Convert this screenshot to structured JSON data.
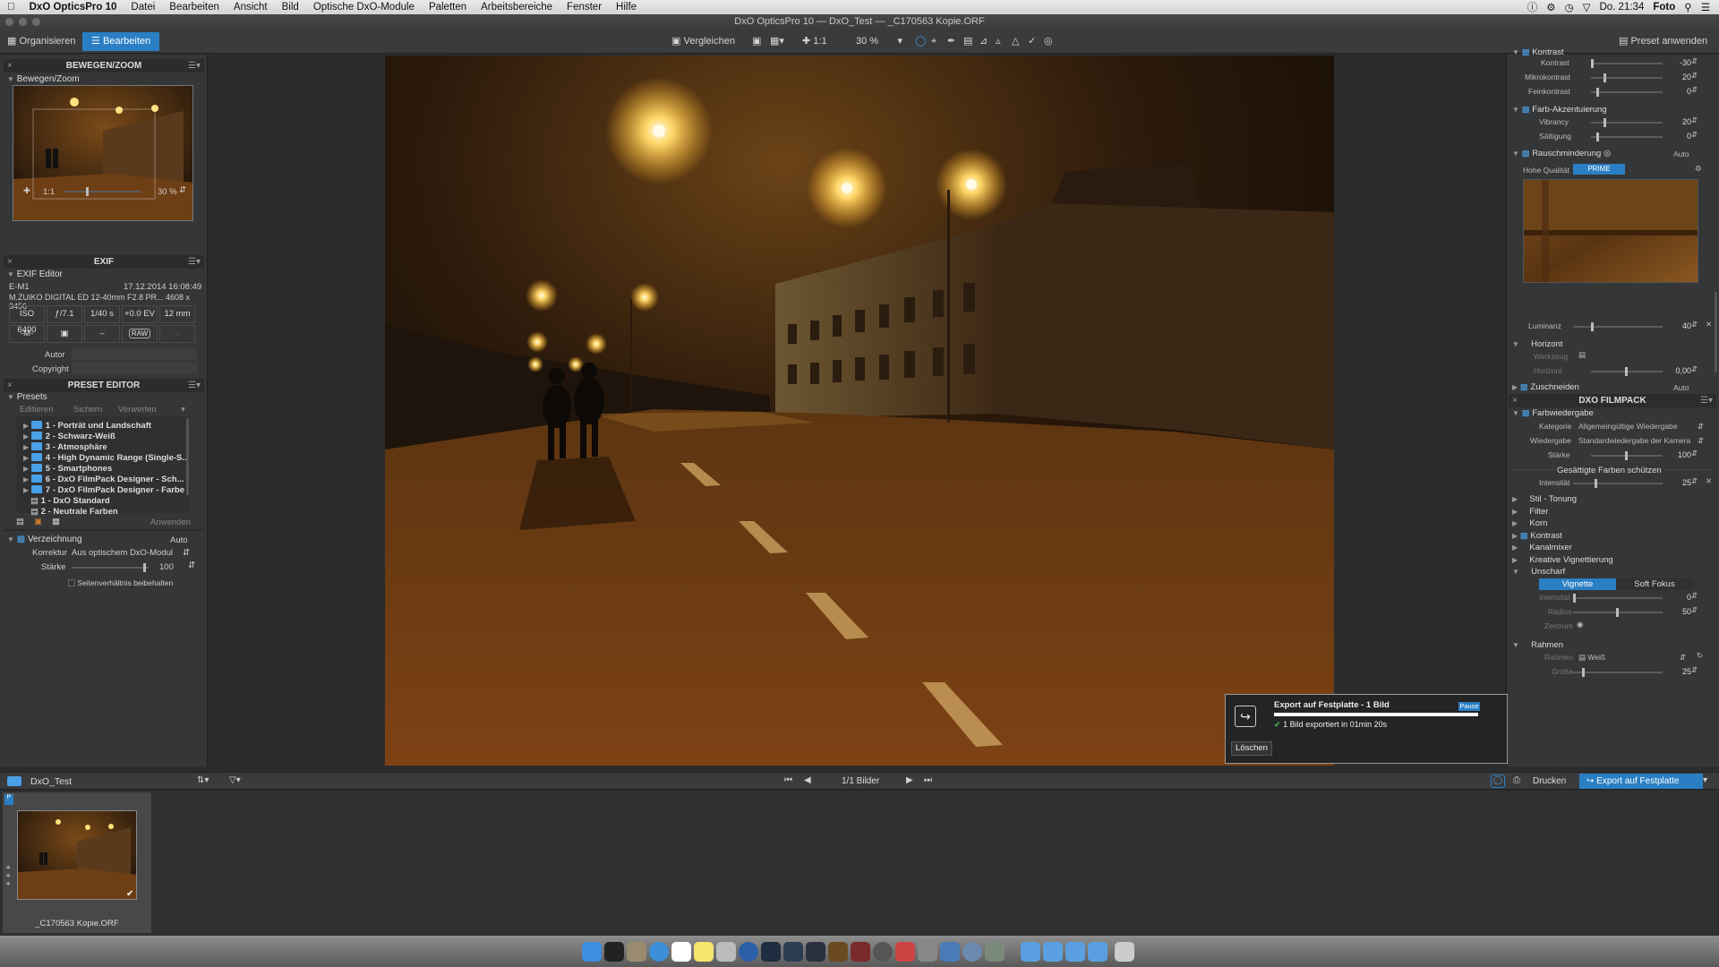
{
  "menubar": {
    "app": "DxO OpticsPro 10",
    "items": [
      "Datei",
      "Bearbeiten",
      "Ansicht",
      "Bild",
      "Optische DxO-Module",
      "Paletten",
      "Arbeitsbereiche",
      "Fenster",
      "Hilfe"
    ],
    "clock": "Do. 21:34",
    "user": "Foto"
  },
  "window": {
    "title": "DxO OpticsPro 10 — DxO_Test — _C170563 Kopie.ORF"
  },
  "toolbar": {
    "tab_organize": "Organisieren",
    "tab_edit": "Bearbeiten",
    "compare": "Vergleichen",
    "one_to_one": "1:1",
    "zoom": "30 %",
    "apply_preset": "Preset anwenden"
  },
  "left": {
    "move_zoom": {
      "header": "BEWEGEN/ZOOM",
      "sub": "Bewegen/Zoom",
      "ratio": "1:1",
      "zoom": "30 %"
    },
    "exif": {
      "header": "EXIF",
      "sub": "EXIF Editor",
      "camera": "E-M1",
      "date": "17.12.2014 16:08:49",
      "lens": "M.ZUIKO DIGITAL ED 12-40mm F2.8 PR... 4608 x 3456",
      "iso": "ISO 6400",
      "aperture": "ƒ/7.1",
      "shutter": "1/40 s",
      "ev": "+0.0 EV",
      "focal": "12 mm",
      "mode": "-M-",
      "flash": "–",
      "raw": "RAW",
      "author_label": "Autor",
      "copyright_label": "Copyright"
    },
    "preset_editor": {
      "header": "PRESET EDITOR",
      "sub": "Presets",
      "edit": "Editieren",
      "save": "Sichern",
      "discard": "Verwerfen",
      "items": [
        "1 - Porträt und Landschaft",
        "2 - Schwarz-Weiß",
        "3 - Atmosphäre",
        "4 - High Dynamic Range (Single-S...",
        "5 - Smartphones",
        "6 - DxO FilmPack Designer - Sch...",
        "7 - DxO FilmPack Designer - Farbe",
        "1 - DxO Standard",
        "2 - Neutrale Farben"
      ],
      "apply": "Anwenden"
    },
    "distortion": {
      "title": "Verzeichnung",
      "auto": "Auto",
      "correction_label": "Korrektur",
      "correction_value": "Aus optischem DxO-Modul",
      "strength_label": "Stärke",
      "strength_value": "100",
      "keep_ratio": "Seitenverhältnis beibehalten"
    }
  },
  "right": {
    "contrast": {
      "title": "Kontrast",
      "contrast_label": "Kontrast",
      "contrast_value": "-30",
      "micro_label": "Mikrokontrast",
      "micro_value": "20",
      "fine_label": "Feinkontrast",
      "fine_value": "0"
    },
    "color_accent": {
      "title": "Farb-Akzentuierung",
      "vibrancy_label": "Vibrancy",
      "vibrancy_value": "20",
      "saturation_label": "Sättigung",
      "saturation_value": "0"
    },
    "noise": {
      "title": "Rauschminderung",
      "auto": "Auto",
      "quality_label": "Hohe Qualität",
      "prime": "PRIME",
      "luminance_label": "Luminanz",
      "luminance_value": "40"
    },
    "horizon": {
      "title": "Horizont",
      "tool_label": "Werkzeug",
      "horizon_label": "Horizont",
      "horizon_value": "0,00"
    },
    "crop": {
      "title": "Zuschneiden",
      "auto": "Auto"
    },
    "filmpack": {
      "header": "DXO FILMPACK",
      "color_render": "Farbwiedergabe",
      "category_label": "Kategorie",
      "category_value": "Allgemeingültige Wiedergabe",
      "render_label": "Wiedergabe",
      "render_value": "Standardwiedergabe der Kamera",
      "strength_label": "Stärke",
      "strength_value": "100",
      "protect": "Gesättigte Farben schützen",
      "intensity_label": "Intensität",
      "intensity_value": "25",
      "sections": [
        "Stil - Tonung",
        "Filter",
        "Korn",
        "Kontrast",
        "Kanalmixer",
        "Kreative Vignettierung",
        "Unscharf"
      ],
      "vignette": "Vignette",
      "soft_focus": "Soft Fokus",
      "v_intensity_label": "Intensität",
      "v_intensity_value": "0",
      "radius_label": "Radius",
      "radius_value": "50",
      "center_label": "Zentrum",
      "frame_title": "Rahmen",
      "frame_label": "Rahmen",
      "frame_value": "Weiß",
      "size_label": "Größe",
      "size_value": "25"
    }
  },
  "bottombar": {
    "folder": "DxO_Test",
    "count": "1/1 Bilder",
    "print": "Drucken",
    "export": "Export auf Festplatte"
  },
  "filmstrip": {
    "filename": "_C170563 Kopie.ORF"
  },
  "export_popup": {
    "title": "Export auf Festplatte - 1 Bild",
    "pause": "Pause",
    "status": "1 Bild exportiert in 01min 20s",
    "delete": "Löschen",
    "progress": 1.0
  }
}
